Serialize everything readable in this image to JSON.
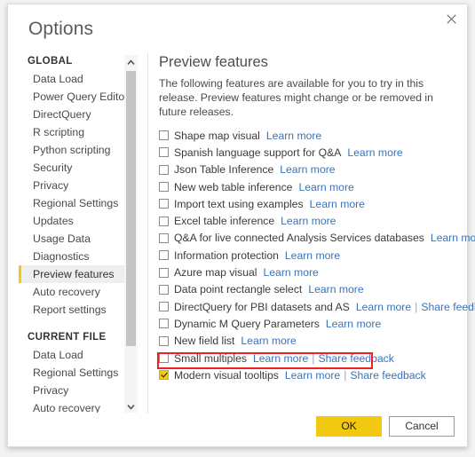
{
  "dialog": {
    "title": "Options",
    "close_icon": "close-icon"
  },
  "sidebar": {
    "groups": [
      {
        "label": "GLOBAL",
        "items": [
          {
            "label": "Data Load",
            "selected": false
          },
          {
            "label": "Power Query Editor",
            "selected": false
          },
          {
            "label": "DirectQuery",
            "selected": false
          },
          {
            "label": "R scripting",
            "selected": false
          },
          {
            "label": "Python scripting",
            "selected": false
          },
          {
            "label": "Security",
            "selected": false
          },
          {
            "label": "Privacy",
            "selected": false
          },
          {
            "label": "Regional Settings",
            "selected": false
          },
          {
            "label": "Updates",
            "selected": false
          },
          {
            "label": "Usage Data",
            "selected": false
          },
          {
            "label": "Diagnostics",
            "selected": false
          },
          {
            "label": "Preview features",
            "selected": true
          },
          {
            "label": "Auto recovery",
            "selected": false
          },
          {
            "label": "Report settings",
            "selected": false
          }
        ]
      },
      {
        "label": "CURRENT FILE",
        "items": [
          {
            "label": "Data Load",
            "selected": false
          },
          {
            "label": "Regional Settings",
            "selected": false
          },
          {
            "label": "Privacy",
            "selected": false
          },
          {
            "label": "Auto recovery",
            "selected": false
          }
        ]
      }
    ],
    "scrollbar": {
      "up_icon": "chevron-up-icon",
      "down_icon": "chevron-down-icon"
    }
  },
  "content": {
    "heading": "Preview features",
    "intro": "The following features are available for you to try in this release. Preview features might change or be removed in future releases.",
    "learn_more_label": "Learn more",
    "share_feedback_label": "Share feedback",
    "separator": "|",
    "features": [
      {
        "label": "Shape map visual",
        "checked": false,
        "learn_more": true,
        "share_feedback": false
      },
      {
        "label": "Spanish language support for Q&A",
        "checked": false,
        "learn_more": true,
        "share_feedback": false
      },
      {
        "label": "Json Table Inference",
        "checked": false,
        "learn_more": true,
        "share_feedback": false
      },
      {
        "label": "New web table inference",
        "checked": false,
        "learn_more": true,
        "share_feedback": false
      },
      {
        "label": "Import text using examples",
        "checked": false,
        "learn_more": true,
        "share_feedback": false
      },
      {
        "label": "Excel table inference",
        "checked": false,
        "learn_more": true,
        "share_feedback": false
      },
      {
        "label": "Q&A for live connected Analysis Services databases",
        "checked": false,
        "learn_more": true,
        "share_feedback": false
      },
      {
        "label": "Information protection",
        "checked": false,
        "learn_more": true,
        "share_feedback": false
      },
      {
        "label": "Azure map visual",
        "checked": false,
        "learn_more": true,
        "share_feedback": false
      },
      {
        "label": "Data point rectangle select",
        "checked": false,
        "learn_more": true,
        "share_feedback": false
      },
      {
        "label": "DirectQuery for PBI datasets and AS",
        "checked": false,
        "learn_more": true,
        "share_feedback": true
      },
      {
        "label": "Dynamic M Query Parameters",
        "checked": false,
        "learn_more": true,
        "share_feedback": false
      },
      {
        "label": "New field list",
        "checked": false,
        "learn_more": true,
        "share_feedback": false
      },
      {
        "label": "Small multiples",
        "checked": false,
        "learn_more": true,
        "share_feedback": true
      },
      {
        "label": "Modern visual tooltips",
        "checked": true,
        "learn_more": true,
        "share_feedback": true
      }
    ],
    "highlighted_feature_index": 14
  },
  "footer": {
    "ok_label": "OK",
    "cancel_label": "Cancel"
  },
  "colors": {
    "accent": "#f2c811",
    "link": "#3b73b9",
    "highlight": "#ee2222"
  }
}
